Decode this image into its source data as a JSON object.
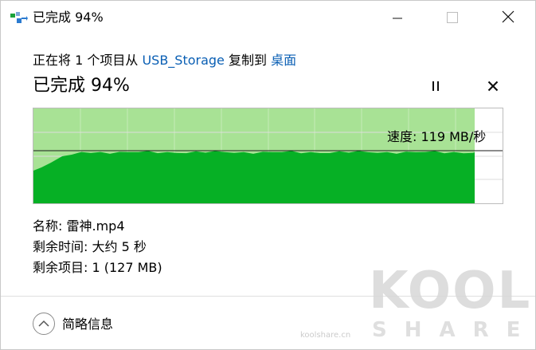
{
  "window": {
    "title": "已完成 94%"
  },
  "copy": {
    "prefix": "正在将 1 个项目从 ",
    "source": "USB_Storage",
    "middle": " 复制到 ",
    "destination": "桌面"
  },
  "progress": {
    "title": "已完成 94%",
    "percent": 94
  },
  "graph": {
    "speed_label": "速度: 119 MB/秒",
    "current_speed_fraction": 0.45
  },
  "details": {
    "name_label": "名称: ",
    "name_value": "雷神.mp4",
    "time_label": "剩余时间: ",
    "time_value": "大约 5 秒",
    "items_label": "剩余项目: ",
    "items_value": "1 (127 MB)"
  },
  "footer": {
    "less_details_label": "简略信息"
  },
  "watermark": {
    "logo": "KOOL",
    "sub": "SHARE",
    "url": "koolshare.cn"
  },
  "colors": {
    "link": "#0a5fb4",
    "graph_fill": "#06b025",
    "graph_remaining": "#a8e295",
    "graph_grid": "#c6ecb8"
  },
  "icons": {
    "app": "copy-icon",
    "minimize": "minimize-icon",
    "maximize": "maximize-icon",
    "close": "close-icon",
    "pause": "pause-icon",
    "cancel": "cancel-icon",
    "toggle": "chevron-up-icon"
  }
}
